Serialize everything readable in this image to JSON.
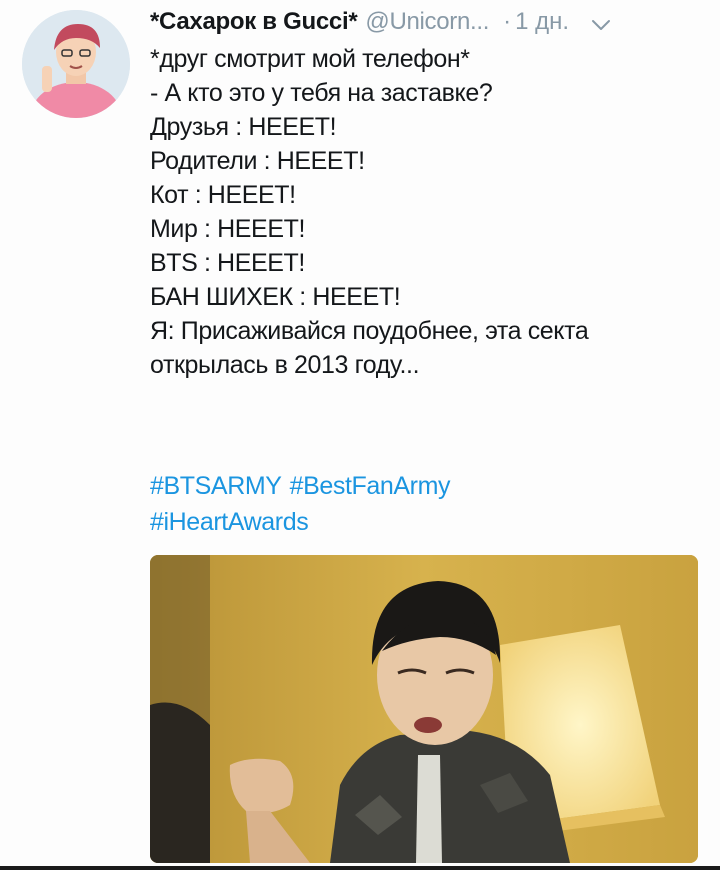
{
  "tweet": {
    "display_name": "*Сахарок в Gucci*",
    "handle": "@Unicorn...",
    "separator": "·",
    "time": "1 дн.",
    "lines": [
      "*друг смотрит мой телефон*",
      "- А кто это у тебя на заставке?",
      "Друзья : НЕЕЕТ!",
      "Родители : НЕЕЕТ!",
      "Кот : НЕЕЕТ!",
      "Мир : НЕЕЕТ!",
      "BTS : НЕЕЕТ!",
      "БАН ШИХЕК : НЕЕЕТ!",
      "Я: Присаживайся поудобнее,  эта секта",
      "открылась в 2013 году..."
    ],
    "hashtags": [
      "#BTSARMY",
      "#BestFanArmy",
      "#iHeartAwards"
    ]
  },
  "icons": {
    "menu": "chevron-down-icon"
  },
  "colors": {
    "text": "#14171a",
    "muted": "#8899a6",
    "link": "#1b95e0"
  }
}
